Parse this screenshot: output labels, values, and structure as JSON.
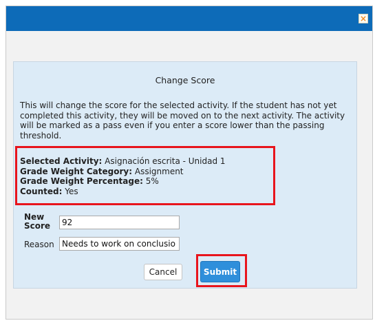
{
  "dialog": {
    "close_glyph": "×",
    "title": "Change Score",
    "description": "This will change the score for the selected activity. If the student has not yet completed this activity, they will be moved on to the next activity. The activity will be marked as a pass even if you enter a score lower than the passing threshold.",
    "info": {
      "selected_activity_label": "Selected Activity:",
      "selected_activity_value": "Asignación escrita - Unidad 1",
      "category_label": "Grade Weight Category:",
      "category_value": "Assignment",
      "percentage_label": "Grade Weight Percentage:",
      "percentage_value": "5%",
      "counted_label": "Counted:",
      "counted_value": "Yes"
    },
    "form": {
      "new_score_label_line1": "New",
      "new_score_label_line2": "Score",
      "new_score_value": "92",
      "reason_label": "Reason",
      "reason_value": "Needs to work on conclusio"
    },
    "buttons": {
      "cancel": "Cancel",
      "submit": "Submit"
    }
  },
  "colors": {
    "titlebar": "#0d6bb8",
    "panel": "#dcebf7",
    "highlight": "#e8141c",
    "submit": "#2f8fdb"
  }
}
